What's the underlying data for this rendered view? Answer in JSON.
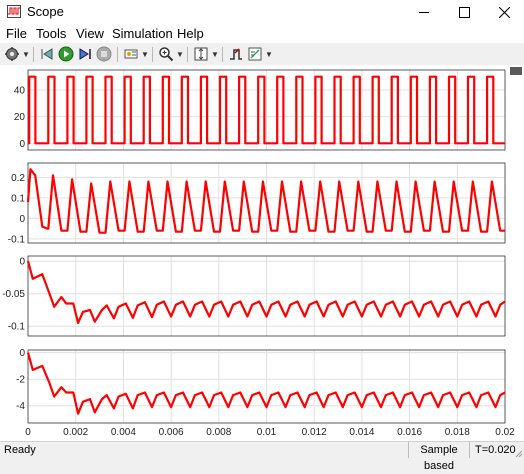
{
  "window": {
    "title": "Scope"
  },
  "menu": [
    {
      "label": "File",
      "id": "file"
    },
    {
      "label": "Tools",
      "id": "tools"
    },
    {
      "label": "View",
      "id": "view"
    },
    {
      "label": "Simulation",
      "id": "simulation"
    },
    {
      "label": "Help",
      "id": "help"
    }
  ],
  "toolbar": {
    "icons": [
      "gear-icon",
      "back-icon",
      "run-icon",
      "step-forward-icon",
      "stop-icon",
      "highlight-icon",
      "zoom-in-icon",
      "autoscale-icon",
      "triggers-icon",
      "measurements-icon"
    ]
  },
  "status": {
    "ready": "Ready",
    "mode": "Sample based",
    "time": "T=0.020"
  },
  "colors": {
    "trace": "#ff0000",
    "grid": "#e0e0e0",
    "axis": "#000000"
  },
  "chart_data": [
    {
      "type": "line",
      "name_id": "plot-1",
      "xlim": [
        0,
        0.02
      ],
      "ylim": [
        -5,
        55
      ],
      "yticks": [
        "0",
        "20",
        "40"
      ],
      "ytick_values": [
        0,
        20,
        40
      ],
      "pulse": {
        "period": 0.0008,
        "first_rise": 5e-05,
        "width": 0.00026,
        "high": 50,
        "low": 0
      }
    },
    {
      "type": "line",
      "name_id": "plot-2",
      "xlim": [
        0,
        0.02
      ],
      "ylim": [
        -0.12,
        0.27
      ],
      "yticks": [
        "0.2",
        "0.1",
        "0",
        "-0.1"
      ],
      "ytick_values": [
        0.2,
        0.1,
        0,
        -0.1
      ],
      "x": [
        0,
        0.0001,
        0.0003,
        0.0006,
        0.0008,
        0.00085,
        0.00105,
        0.0014,
        0.0016,
        0.00165,
        0.00185,
        0.0022,
        0.0024,
        0.00245,
        0.00265,
        0.003,
        0.0032,
        0.00325,
        0.00345,
        0.0038,
        0.004,
        0.00405,
        0.00425,
        0.0046,
        0.0048,
        0.00485,
        0.00505,
        0.0054,
        0.0056,
        0.00565,
        0.00585,
        0.0062,
        0.0064,
        0.00645,
        0.00665,
        0.007,
        0.0072,
        0.00725,
        0.00745,
        0.0078,
        0.008,
        0.00805,
        0.00825,
        0.0086,
        0.0088,
        0.00885,
        0.00905,
        0.0094,
        0.0096,
        0.00965,
        0.00985,
        0.0102,
        0.0104,
        0.01045,
        0.01065,
        0.011,
        0.0112,
        0.01125,
        0.01145,
        0.0118,
        0.012,
        0.01205,
        0.01225,
        0.0126,
        0.0128,
        0.01285,
        0.01305,
        0.0134,
        0.0136,
        0.01365,
        0.01385,
        0.0142,
        0.0144,
        0.01445,
        0.01465,
        0.015,
        0.0152,
        0.01525,
        0.01545,
        0.0158,
        0.016,
        0.01605,
        0.01625,
        0.0166,
        0.0168,
        0.01685,
        0.01705,
        0.0174,
        0.0176,
        0.01765,
        0.01785,
        0.0182,
        0.0184,
        0.01845,
        0.01865,
        0.019,
        0.0192,
        0.01925,
        0.01945,
        0.0198,
        0.02
      ],
      "y": [
        0.08,
        0.24,
        0.21,
        -0.04,
        -0.05,
        -0.05,
        0.21,
        -0.06,
        -0.06,
        -0.06,
        0.19,
        -0.065,
        -0.065,
        -0.065,
        0.17,
        -0.07,
        -0.07,
        -0.07,
        0.18,
        -0.06,
        -0.06,
        -0.06,
        0.18,
        -0.065,
        -0.065,
        -0.065,
        0.18,
        -0.06,
        -0.06,
        -0.06,
        0.18,
        -0.065,
        -0.065,
        -0.065,
        0.18,
        -0.06,
        -0.06,
        -0.06,
        0.18,
        -0.065,
        -0.065,
        -0.065,
        0.18,
        -0.06,
        -0.06,
        -0.06,
        0.18,
        -0.065,
        -0.065,
        -0.065,
        0.18,
        -0.06,
        -0.06,
        -0.06,
        0.18,
        -0.065,
        -0.065,
        -0.065,
        0.18,
        -0.06,
        -0.06,
        -0.06,
        0.18,
        -0.065,
        -0.065,
        -0.065,
        0.18,
        -0.06,
        -0.06,
        -0.06,
        0.18,
        -0.065,
        -0.065,
        -0.065,
        0.18,
        -0.06,
        -0.06,
        -0.06,
        0.18,
        -0.065,
        -0.065,
        -0.065,
        0.18,
        -0.06,
        -0.06,
        -0.06,
        0.18,
        -0.065,
        -0.065,
        -0.065,
        0.18,
        -0.06,
        -0.06,
        -0.06,
        0.18,
        -0.065,
        -0.065,
        -0.065,
        0.18,
        -0.06,
        -0.06
      ]
    },
    {
      "type": "line",
      "name_id": "plot-3",
      "xlim": [
        0,
        0.02
      ],
      "ylim": [
        -0.115,
        0.008
      ],
      "yticks": [
        "0",
        "-0.05",
        "-0.1"
      ],
      "ytick_values": [
        0,
        -0.05,
        -0.1
      ],
      "x": [
        0,
        0.0002,
        0.0006,
        0.0009,
        0.0011,
        0.0014,
        0.0016,
        0.0019,
        0.0021,
        0.0023,
        0.0026,
        0.0028,
        0.0031,
        0.0033,
        0.0036,
        0.0038,
        0.0041,
        0.0044,
        0.0046,
        0.0049,
        0.0052,
        0.0054,
        0.0057,
        0.006,
        0.0062,
        0.0065,
        0.0068,
        0.007,
        0.0073,
        0.0076,
        0.0078,
        0.0081,
        0.0084,
        0.0086,
        0.0089,
        0.0092,
        0.0094,
        0.0097,
        0.01,
        0.0102,
        0.0105,
        0.0108,
        0.011,
        0.0113,
        0.0116,
        0.0118,
        0.0121,
        0.0124,
        0.0126,
        0.0129,
        0.0132,
        0.0134,
        0.0137,
        0.014,
        0.0142,
        0.0145,
        0.0148,
        0.015,
        0.0153,
        0.0156,
        0.0158,
        0.0161,
        0.0164,
        0.0166,
        0.0169,
        0.0172,
        0.0174,
        0.0177,
        0.018,
        0.0182,
        0.0185,
        0.0188,
        0.019,
        0.0193,
        0.0196,
        0.0198,
        0.02
      ],
      "y": [
        0,
        -0.027,
        -0.02,
        -0.05,
        -0.07,
        -0.055,
        -0.065,
        -0.065,
        -0.095,
        -0.078,
        -0.075,
        -0.093,
        -0.075,
        -0.068,
        -0.088,
        -0.07,
        -0.065,
        -0.087,
        -0.068,
        -0.063,
        -0.086,
        -0.067,
        -0.062,
        -0.085,
        -0.067,
        -0.062,
        -0.085,
        -0.067,
        -0.062,
        -0.085,
        -0.067,
        -0.062,
        -0.085,
        -0.067,
        -0.062,
        -0.085,
        -0.067,
        -0.062,
        -0.085,
        -0.067,
        -0.062,
        -0.085,
        -0.067,
        -0.062,
        -0.085,
        -0.067,
        -0.062,
        -0.085,
        -0.067,
        -0.062,
        -0.085,
        -0.067,
        -0.062,
        -0.085,
        -0.067,
        -0.062,
        -0.085,
        -0.067,
        -0.062,
        -0.085,
        -0.067,
        -0.062,
        -0.085,
        -0.067,
        -0.062,
        -0.085,
        -0.067,
        -0.062,
        -0.085,
        -0.067,
        -0.062,
        -0.085,
        -0.067,
        -0.062,
        -0.085,
        -0.067,
        -0.062
      ]
    },
    {
      "type": "line",
      "name_id": "plot-4",
      "xlim": [
        0,
        0.02
      ],
      "ylim": [
        -5.3,
        0.2
      ],
      "yticks": [
        "0",
        "-2",
        "-4"
      ],
      "ytick_values": [
        0,
        -2,
        -4
      ],
      "xticks": [
        "0",
        "0.002",
        "0.004",
        "0.006",
        "0.008",
        "0.01",
        "0.012",
        "0.014",
        "0.016",
        "0.018",
        "0.02"
      ],
      "xtick_values": [
        0,
        0.002,
        0.004,
        0.006,
        0.008,
        0.01,
        0.012,
        0.014,
        0.016,
        0.018,
        0.02
      ],
      "x": [
        0,
        0.0002,
        0.0006,
        0.0009,
        0.0011,
        0.0014,
        0.0016,
        0.0019,
        0.0021,
        0.0023,
        0.0026,
        0.0028,
        0.0031,
        0.0033,
        0.0036,
        0.0038,
        0.0041,
        0.0044,
        0.0046,
        0.0049,
        0.0052,
        0.0054,
        0.0057,
        0.006,
        0.0062,
        0.0065,
        0.0068,
        0.007,
        0.0073,
        0.0076,
        0.0078,
        0.0081,
        0.0084,
        0.0086,
        0.0089,
        0.0092,
        0.0094,
        0.0097,
        0.01,
        0.0102,
        0.0105,
        0.0108,
        0.011,
        0.0113,
        0.0116,
        0.0118,
        0.0121,
        0.0124,
        0.0126,
        0.0129,
        0.0132,
        0.0134,
        0.0137,
        0.014,
        0.0142,
        0.0145,
        0.0148,
        0.015,
        0.0153,
        0.0156,
        0.0158,
        0.0161,
        0.0164,
        0.0166,
        0.0169,
        0.0172,
        0.0174,
        0.0177,
        0.018,
        0.0182,
        0.0185,
        0.0188,
        0.019,
        0.0193,
        0.0196,
        0.0198,
        0.02
      ],
      "y": [
        0,
        -1.3,
        -1.0,
        -2.3,
        -3.3,
        -2.6,
        -3.0,
        -3.0,
        -4.6,
        -3.7,
        -3.5,
        -4.5,
        -3.5,
        -3.2,
        -4.2,
        -3.3,
        -3.1,
        -4.2,
        -3.2,
        -3.0,
        -4.1,
        -3.2,
        -3.0,
        -4.1,
        -3.2,
        -3.0,
        -4.1,
        -3.2,
        -3.0,
        -4.1,
        -3.2,
        -3.0,
        -4.1,
        -3.2,
        -3.0,
        -4.1,
        -3.2,
        -3.0,
        -4.1,
        -3.2,
        -3.0,
        -4.1,
        -3.2,
        -3.0,
        -4.1,
        -3.2,
        -3.0,
        -4.1,
        -3.2,
        -3.0,
        -4.1,
        -3.2,
        -3.0,
        -4.1,
        -3.2,
        -3.0,
        -4.1,
        -3.2,
        -3.0,
        -4.1,
        -3.2,
        -3.0,
        -4.1,
        -3.2,
        -3.0,
        -4.1,
        -3.2,
        -3.0,
        -4.1,
        -3.2,
        -3.0,
        -4.1,
        -3.2,
        -3.0,
        -4.1,
        -3.2,
        -3.0
      ]
    }
  ]
}
